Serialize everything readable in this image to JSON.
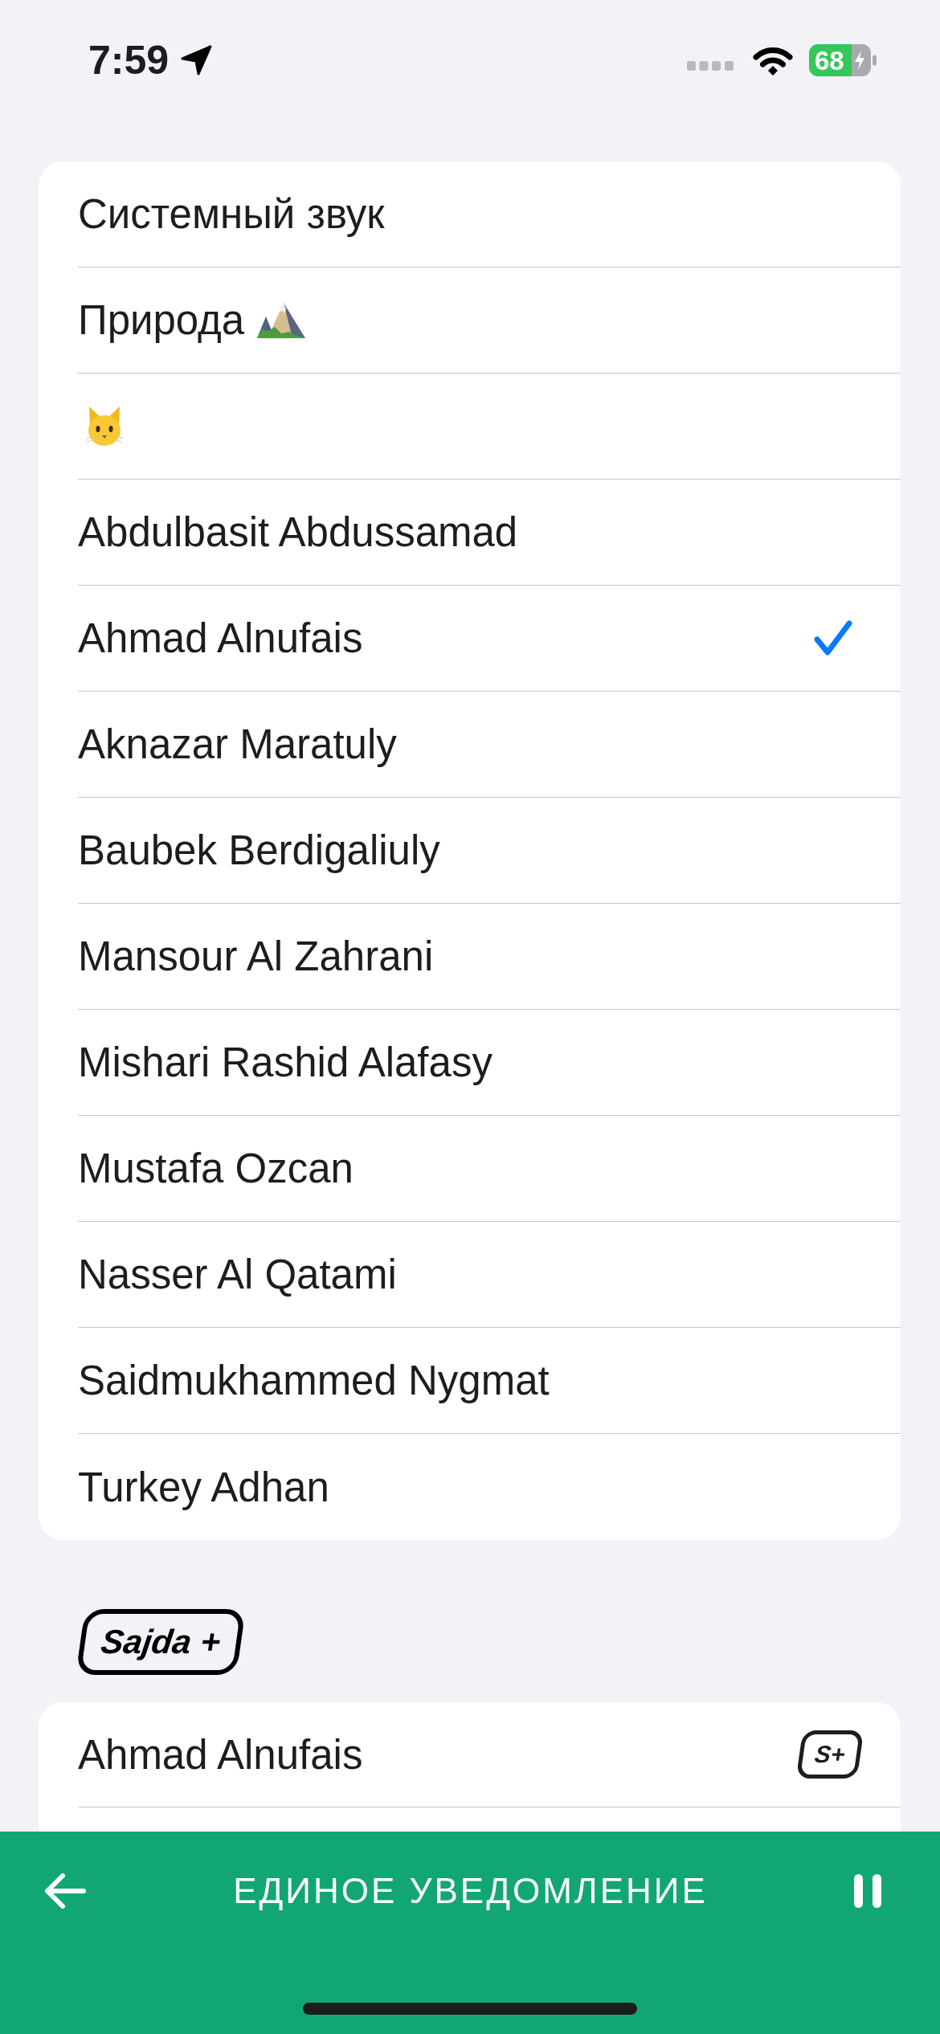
{
  "status_bar": {
    "time": "7:59",
    "battery": "68"
  },
  "sound_list": {
    "items": [
      {
        "label": "Системный звук",
        "kind": "text",
        "selected": false
      },
      {
        "label": "Природа",
        "kind": "text_icon",
        "selected": false
      },
      {
        "kind": "icon",
        "selected": false
      },
      {
        "label": "Abdulbasit Abdussamad",
        "kind": "text",
        "selected": false
      },
      {
        "label": "Ahmad Alnufais",
        "kind": "text",
        "selected": true
      },
      {
        "label": "Aknazar Maratuly",
        "kind": "text",
        "selected": false
      },
      {
        "label": "Baubek Berdigaliuly",
        "kind": "text",
        "selected": false
      },
      {
        "label": "Mansour Al Zahrani",
        "kind": "text",
        "selected": false
      },
      {
        "label": "Mishari Rashid Alafasy",
        "kind": "text",
        "selected": false
      },
      {
        "label": "Mustafa Ozcan",
        "kind": "text",
        "selected": false
      },
      {
        "label": "Nasser Al Qatami",
        "kind": "text",
        "selected": false
      },
      {
        "label": "Saidmukhammed Nygmat",
        "kind": "text",
        "selected": false
      },
      {
        "label": "Turkey Adhan",
        "kind": "text",
        "selected": false
      }
    ]
  },
  "premium_section": {
    "logo": "Sajda +",
    "items": [
      {
        "label": "Ahmad Alnufais",
        "badge": "S+",
        "selected": false
      }
    ]
  },
  "bottom_bar": {
    "title": "ЕДИНОЕ УВЕДОМЛЕНИЕ"
  }
}
